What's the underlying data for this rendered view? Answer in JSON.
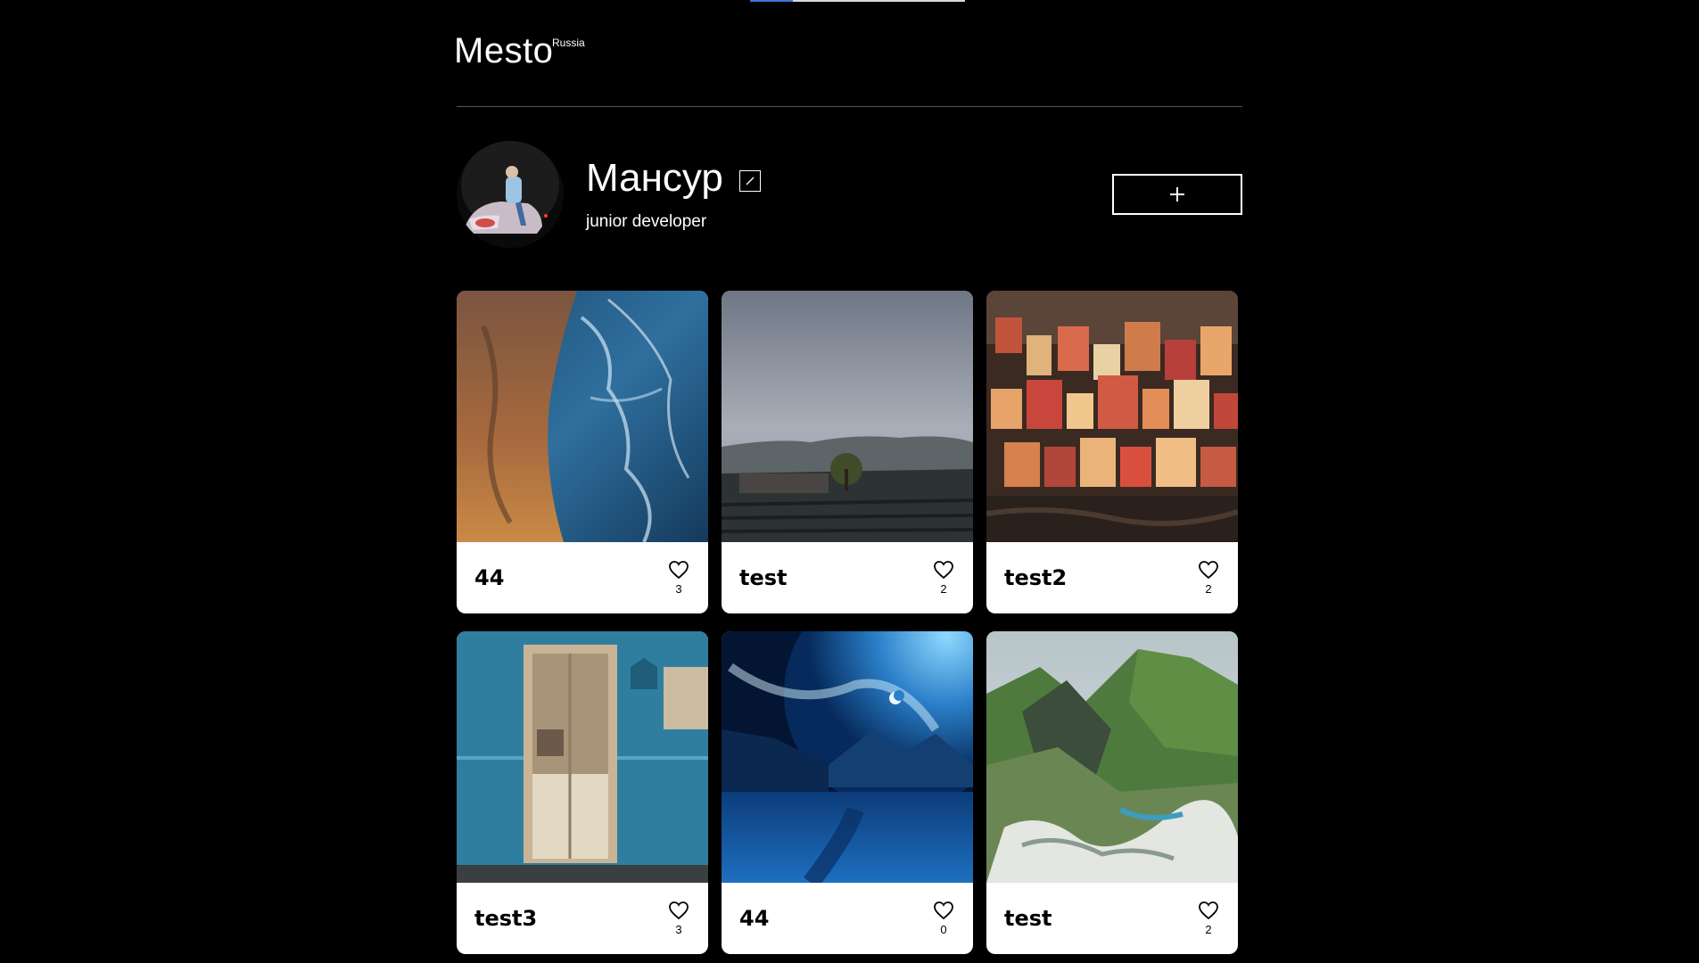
{
  "header": {
    "logo": "Mesto",
    "logo_sup": "Russia"
  },
  "profile": {
    "name": "Мансур",
    "about": "junior developer",
    "add_label": "+"
  },
  "cards": [
    {
      "title": "44",
      "likes": "3"
    },
    {
      "title": "test",
      "likes": "2"
    },
    {
      "title": "test2",
      "likes": "2"
    },
    {
      "title": "test3",
      "likes": "3"
    },
    {
      "title": "44",
      "likes": "0"
    },
    {
      "title": "test",
      "likes": "2"
    }
  ],
  "colors": {
    "background": "#000000",
    "card": "#ffffff",
    "divider": "#545454"
  }
}
